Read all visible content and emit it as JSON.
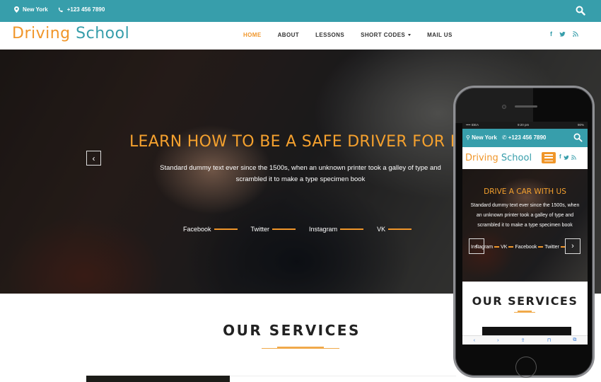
{
  "topbar": {
    "location": "New York",
    "phone": "+123 456 7890",
    "icons": {
      "location": "map-pin-icon",
      "phone": "phone-icon",
      "search": "search-icon"
    }
  },
  "header": {
    "logo_part1": "Driving",
    "logo_part2": "School",
    "nav": [
      {
        "label": "HOME",
        "active": true
      },
      {
        "label": "ABOUT",
        "active": false
      },
      {
        "label": "LESSONS",
        "active": false
      },
      {
        "label": "SHORT CODES",
        "active": false,
        "dropdown": true
      },
      {
        "label": "MAIL US",
        "active": false
      }
    ],
    "social": [
      {
        "icon": "facebook-icon",
        "glyph": "f"
      },
      {
        "icon": "twitter-icon",
        "glyph": "t"
      },
      {
        "icon": "rss-icon",
        "glyph": "rss"
      }
    ]
  },
  "hero": {
    "title": "LEARN HOW TO BE A SAFE DRIVER FOR LI",
    "text": "Standard dummy text ever since the 1500s, when an unknown printer took a galley of type and scrambled it to make a type specimen book",
    "prev_glyph": "‹",
    "social_links": [
      "Facebook",
      "Twitter",
      "Instagram",
      "VK"
    ]
  },
  "services": {
    "title": "OUR SERVICES"
  },
  "mobile": {
    "status": {
      "carrier": "•••• IDEA",
      "time": "9:20 pm",
      "battery": "90%"
    },
    "location": "New York",
    "phone": "+123 456 7890",
    "logo_part1": "Driving",
    "logo_part2": "School",
    "social": "f",
    "hero_title": "DRIVE A CAR WITH US",
    "hero_text": "Standard dummy text ever since the 1500s, when an unknown printer took a galley of type and scrambled it to make a type specimen book",
    "hero_social": [
      "Instagram",
      "VK",
      "Facebook",
      "Twitter"
    ],
    "prev_glyph": "‹",
    "next_glyph": "›",
    "services_title": "OUR SERVICES",
    "bottom_icons": [
      "back-icon",
      "forward-icon",
      "share-icon",
      "bookmarks-icon",
      "tabs-icon"
    ]
  },
  "colors": {
    "teal": "#379eab",
    "orange": "#f0962a"
  }
}
